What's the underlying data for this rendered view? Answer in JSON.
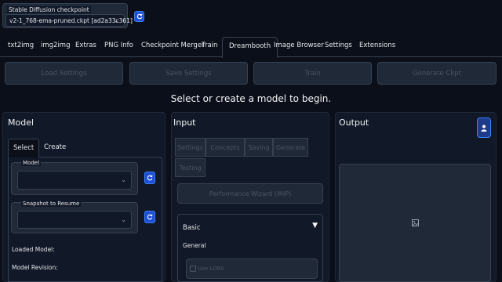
{
  "checkpoint": {
    "label": "Stable Diffusion checkpoint",
    "value": "v2-1_768-ema-pruned.ckpt [ad2a33c361]"
  },
  "tabs": [
    {
      "label": "txt2img",
      "active": false
    },
    {
      "label": "img2img",
      "active": false
    },
    {
      "label": "Extras",
      "active": false
    },
    {
      "label": "PNG Info",
      "active": false
    },
    {
      "label": "Checkpoint Merger",
      "active": false
    },
    {
      "label": "Train",
      "active": false
    },
    {
      "label": "Dreambooth",
      "active": true
    },
    {
      "label": "Image Browser",
      "active": false
    },
    {
      "label": "Settings",
      "active": false
    },
    {
      "label": "Extensions",
      "active": false
    }
  ],
  "actions": {
    "load_settings": "Load Settings",
    "save_settings": "Save Settings",
    "train": "Train",
    "generate_ckpt": "Generate Ckpt"
  },
  "headline": "Select or create a model to begin.",
  "model_panel": {
    "title": "Model",
    "subtabs": [
      {
        "label": "Select",
        "active": true
      },
      {
        "label": "Create",
        "active": false
      }
    ],
    "model_label": "Model",
    "snapshot_label": "Snapshot to Resume",
    "loaded_model_label": "Loaded Model:",
    "model_revision_label": "Model Revision:"
  },
  "input_panel": {
    "title": "Input",
    "tabs": [
      {
        "label": "Settings"
      },
      {
        "label": "Concepts"
      },
      {
        "label": "Saving"
      },
      {
        "label": "Generate"
      },
      {
        "label": "Testing"
      }
    ],
    "performance_wizard": "Performance Wizard (WIP)",
    "basic_label": "Basic",
    "general_label": "General",
    "use_lora_label": "Use LORA"
  },
  "output_panel": {
    "title": "Output"
  },
  "colors": {
    "background": "#0b0f19",
    "panel": "#111827",
    "accent_blue": "#1d4ed8"
  }
}
